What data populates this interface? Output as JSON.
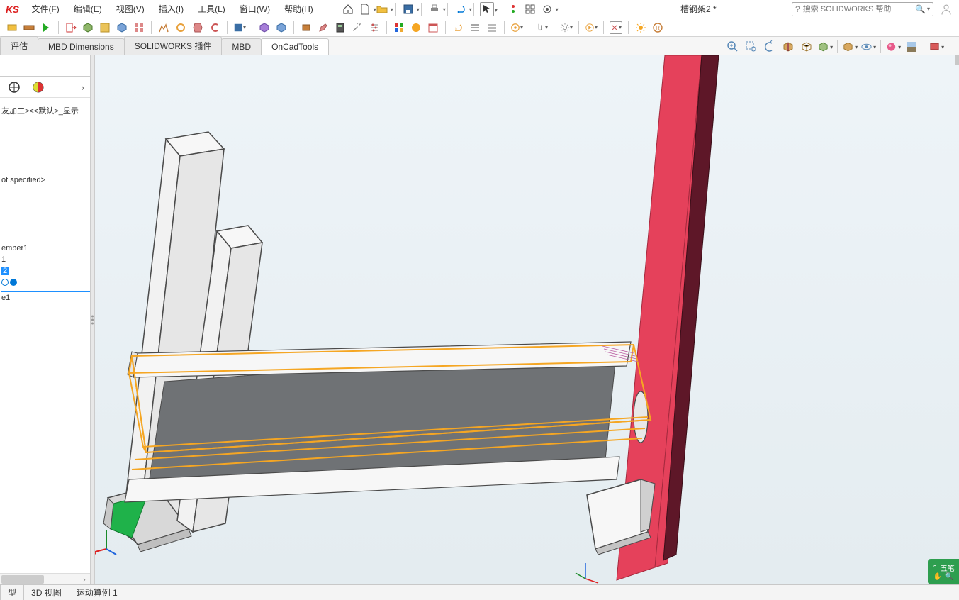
{
  "app": {
    "logo": "KS",
    "doc_title": "槽钢架2 *"
  },
  "menu": {
    "file": "文件(F)",
    "edit": "编辑(E)",
    "view": "视图(V)",
    "insert": "插入(I)",
    "tools": "工具(L)",
    "window": "窗口(W)",
    "help": "帮助(H)"
  },
  "search": {
    "placeholder": "搜索 SOLIDWORKS 帮助"
  },
  "cmdtabs": {
    "evaluate": "评估",
    "mbd_dim": "MBD Dimensions",
    "sw_addin": "SOLIDWORKS 插件",
    "mbd": "MBD",
    "oncad": "OnCadTools"
  },
  "tree": {
    "top_text": "友加工><<默认>_显示",
    "not_spec": "ot specified>",
    "member": "ember1",
    "item1": "1",
    "item2": "2",
    "sel": "e1"
  },
  "bottom": {
    "model": "型",
    "view3d": "3D 视图",
    "motion": "运动算例 1"
  },
  "ime": {
    "label": "五笔"
  },
  "colors": {
    "red": "#e5415b",
    "darkred": "#5e1728",
    "green": "#1fb24a",
    "orange": "#f5a623",
    "grey": "#6f7275",
    "edge": "#4a4a4a",
    "white": "#f7f7f7"
  }
}
